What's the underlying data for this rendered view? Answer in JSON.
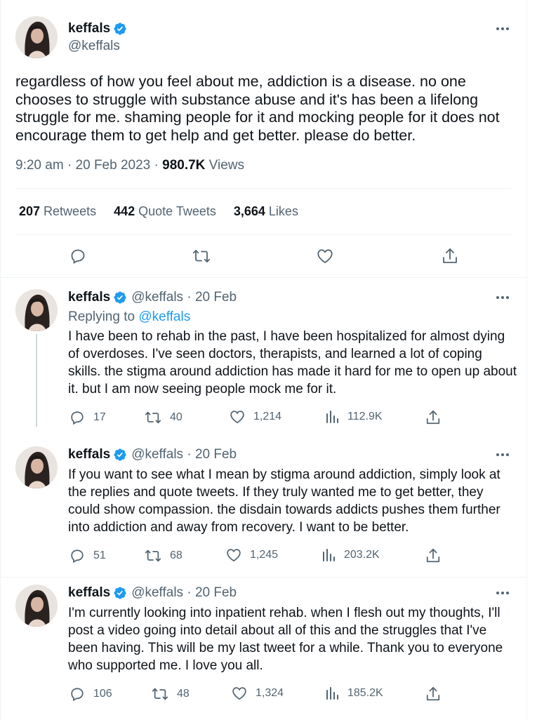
{
  "main_tweet": {
    "name": "keffals",
    "handle": "@keffals",
    "text": "regardless of how you feel about me, addiction is a disease. no one chooses to struggle with substance abuse and it's has been a lifelong struggle for me. shaming people for it and mocking people for it does not encourage them to get help and get better. please do better.",
    "time": "9:20 am · 20 Feb 2023 · ",
    "views_count": "980.7K",
    "views_label": " Views",
    "retweets_count": "207",
    "retweets_label": " Retweets",
    "quotes_count": "442",
    "quotes_label": " Quote Tweets",
    "likes_count": "3,664",
    "likes_label": " Likes"
  },
  "replies": [
    {
      "name": "keffals",
      "handle": "@keffals · 20 Feb",
      "replying_prefix": "Replying to ",
      "replying_to": "@keffals",
      "text": "I have been to rehab in the past, I have been hospitalized for almost dying of overdoses. I've seen doctors, therapists, and learned a lot of coping skills. the stigma around addiction has made it hard for me to open up about it. but I am now seeing people mock me for it.",
      "replies": "17",
      "retweets": "40",
      "likes": "1,214",
      "views": "112.9K"
    },
    {
      "name": "keffals",
      "handle": "@keffals · 20 Feb",
      "text": "If you want to see what I mean by stigma around addiction, simply look at the replies and quote tweets. If they truly wanted me to get better, they could show compassion. the disdain towards addicts pushes them further into addiction and away from recovery. I want to be better.",
      "replies": "51",
      "retweets": "68",
      "likes": "1,245",
      "views": "203.2K"
    },
    {
      "name": "keffals",
      "handle": "@keffals · 20 Feb",
      "text": "I'm currently looking into inpatient rehab. when I flesh out my thoughts, I'll post a video going into detail about all of this and the struggles that I've been having. This will be my last tweet for a while. Thank you to everyone who supported me. I love you all.",
      "replies": "106",
      "retweets": "48",
      "likes": "1,324",
      "views": "185.2K"
    }
  ],
  "icons": {
    "verified": "verified-badge-icon",
    "more": "more-icon",
    "reply": "reply-icon",
    "retweet": "retweet-icon",
    "like": "like-icon",
    "views": "views-icon",
    "share": "share-icon"
  },
  "colors": {
    "accent": "#1d9bf0",
    "text": "#0f1419",
    "secondary": "#536471",
    "divider": "#eff3f4"
  }
}
